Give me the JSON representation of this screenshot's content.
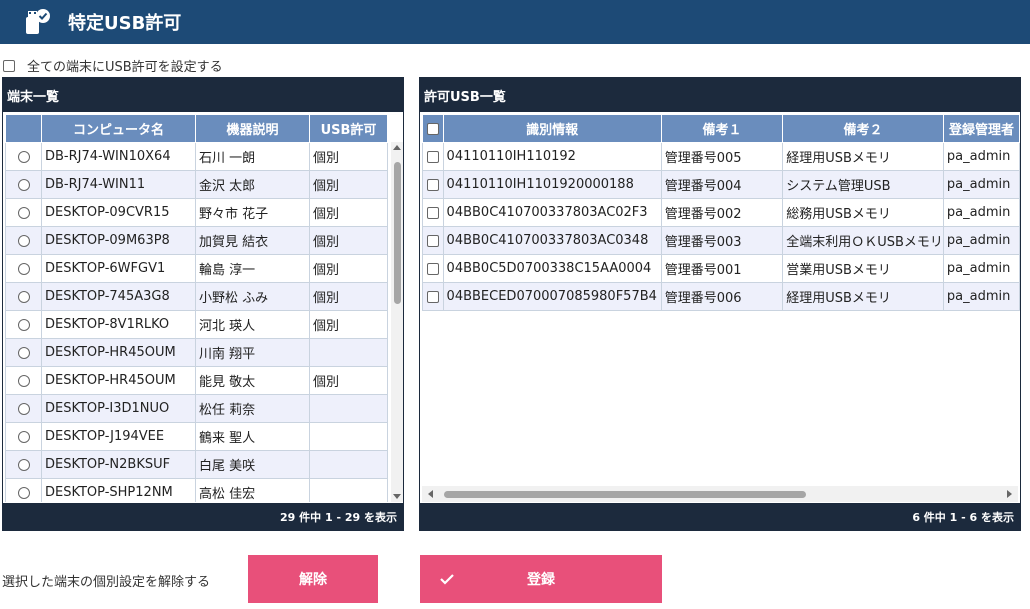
{
  "header": {
    "title": "特定USB許可"
  },
  "all_terminals": {
    "label": "全ての端末にUSB許可を設定する"
  },
  "left_panel": {
    "title": "端末一覧",
    "columns": [
      "コンピュータ名",
      "機器説明",
      "USB許可"
    ],
    "rows": [
      {
        "name": "DB-RJ74-WIN10X64",
        "desc": "石川 一朗",
        "usb": "個別"
      },
      {
        "name": "DB-RJ74-WIN11",
        "desc": "金沢 太郎",
        "usb": "個別"
      },
      {
        "name": "DESKTOP-09CVR15",
        "desc": "野々市 花子",
        "usb": "個別"
      },
      {
        "name": "DESKTOP-09M63P8",
        "desc": "加賀見 結衣",
        "usb": "個別"
      },
      {
        "name": "DESKTOP-6WFGV1",
        "desc": "輪島 淳一",
        "usb": "個別"
      },
      {
        "name": "DESKTOP-745A3G8",
        "desc": "小野松 ふみ",
        "usb": "個別"
      },
      {
        "name": "DESKTOP-8V1RLKO",
        "desc": "河北 瑛人",
        "usb": "個別"
      },
      {
        "name": "DESKTOP-HR45OUM",
        "desc": "川南 翔平",
        "usb": ""
      },
      {
        "name": "DESKTOP-HR45OUM",
        "desc": "能見 敬太",
        "usb": "個別"
      },
      {
        "name": "DESKTOP-I3D1NUO",
        "desc": "松任 莉奈",
        "usb": ""
      },
      {
        "name": "DESKTOP-J194VEE",
        "desc": "鶴来 聖人",
        "usb": ""
      },
      {
        "name": "DESKTOP-N2BKSUF",
        "desc": "白尾 美咲",
        "usb": ""
      },
      {
        "name": "DESKTOP-SHP12NM",
        "desc": "高松 佳宏",
        "usb": ""
      }
    ],
    "footer": "29 件中 1 - 29 を表示"
  },
  "right_panel": {
    "title": "許可USB一覧",
    "columns": [
      "識別情報",
      "備考１",
      "備考２",
      "登録管理者"
    ],
    "rows": [
      {
        "id": "04110110IH110192",
        "note1": "管理番号005",
        "note2": "経理用USBメモリ",
        "admin": "pa_admin"
      },
      {
        "id": "04110110IH1101920000188",
        "note1": "管理番号004",
        "note2": "システム管理USB",
        "admin": "pa_admin"
      },
      {
        "id": "04BB0C410700337803AC02F3",
        "note1": "管理番号002",
        "note2": "総務用USBメモリ",
        "admin": "pa_admin"
      },
      {
        "id": "04BB0C410700337803AC0348",
        "note1": "管理番号003",
        "note2": "全端末利用ＯＫUSBメモリ",
        "admin": "pa_admin"
      },
      {
        "id": "04BB0C5D0700338C15AA0004",
        "note1": "管理番号001",
        "note2": "営業用USBメモリ",
        "admin": "pa_admin"
      },
      {
        "id": "04BBECED070007085980F57B4",
        "note1": "管理番号006",
        "note2": "経理用USBメモリ",
        "admin": "pa_admin"
      }
    ],
    "footer": "6 件中 1 - 6 を表示"
  },
  "actions": {
    "release_label_text": "選択した端末の個別設定を解除する",
    "release_button": "解除",
    "register_button": "登録"
  },
  "colors": {
    "header": "#1d4a76",
    "panel": "#1c2a3d",
    "table_header": "#6a8dbd",
    "button": "#e8507a"
  }
}
